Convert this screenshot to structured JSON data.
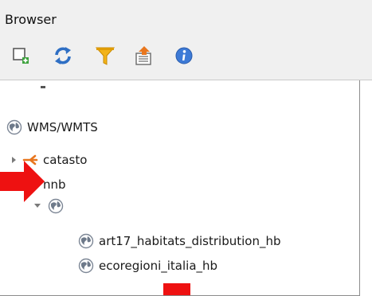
{
  "panel": {
    "title": "Browser"
  },
  "toolbar": {
    "buttons": [
      {
        "name": "add-selected-layers-button",
        "icon": "add-layer-icon"
      },
      {
        "name": "refresh-button",
        "icon": "refresh-icon"
      },
      {
        "name": "filter-button",
        "icon": "filter-icon"
      },
      {
        "name": "collapse-all-button",
        "icon": "collapse-icon"
      },
      {
        "name": "properties-button",
        "icon": "info-icon"
      }
    ]
  },
  "tree": {
    "root": {
      "label": "WMS/WMTS",
      "icon": "globe-icon"
    },
    "connections": [
      {
        "label": "catasto",
        "icon": "connection-icon",
        "expanded": false
      },
      {
        "label": "nnb",
        "icon": "connection-icon",
        "expanded": true
      }
    ],
    "group": {
      "label": "",
      "icon": "globe-icon",
      "expanded": true
    },
    "layers": [
      {
        "label": "art17_habitats_distribution_hb",
        "icon": "globe-icon"
      },
      {
        "label": "ecoregioni_italia_hb",
        "icon": "globe-icon"
      }
    ]
  },
  "colors": {
    "annotation_red": "#ee1111",
    "connection_orange": "#e8761e",
    "panel_bg": "#f0f0f0"
  }
}
